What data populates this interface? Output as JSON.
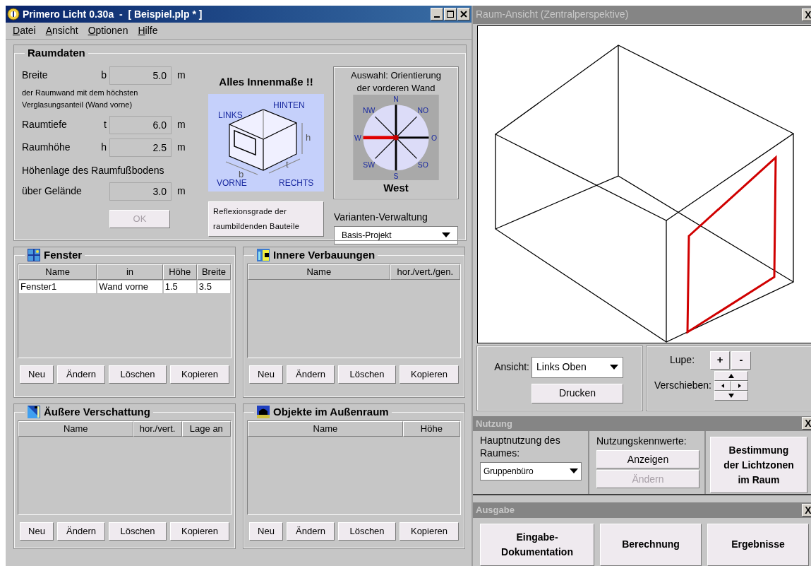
{
  "main_window": {
    "title": "Primero Licht 0.30a  -  [ Beispiel.plp * ]",
    "menu": [
      "Datei",
      "Ansicht",
      "Optionen",
      "Hilfe"
    ]
  },
  "raumdaten": {
    "title": "Raumdaten",
    "fields": [
      {
        "label": "Breite",
        "symbol": "b",
        "value": "5.0",
        "unit": "m"
      },
      {
        "label": "Raumtiefe",
        "symbol": "t",
        "value": "6.0",
        "unit": "m"
      },
      {
        "label": "Raumhöhe",
        "symbol": "h",
        "value": "2.5",
        "unit": "m"
      }
    ],
    "note": "der Raumwand mit dem höchsten Verglasungsanteil (Wand vorne)",
    "floor": {
      "label_1": "Höhenlage des Raumfußbodens",
      "label_2": "über Gelände",
      "value": "3.0",
      "unit": "m"
    },
    "ok_button": {
      "label": "OK",
      "disabled": true
    },
    "diagram": {
      "heading": "Alles Innenmaße !!",
      "labels": [
        "LINKS",
        "HINTEN",
        "h",
        "b",
        "t",
        "VORNE",
        "RECHTS"
      ]
    },
    "reflexion_button": "Reflexionsgrade der raumbildenden Bauteile",
    "orientation": {
      "title": "Auswahl: Orientierung der vorderen Wand",
      "result": "West",
      "directions": [
        {
          "label": "N",
          "selected": false
        },
        {
          "label": "NO",
          "selected": false
        },
        {
          "label": "O",
          "selected": false
        },
        {
          "label": "SO",
          "selected": false
        },
        {
          "label": "S",
          "selected": false
        },
        {
          "label": "SW",
          "selected": false
        },
        {
          "label": "W",
          "selected": true
        },
        {
          "label": "NW",
          "selected": false
        }
      ]
    },
    "varianten": {
      "label": "Varianten-Verwaltung",
      "value": "Basis-Projekt"
    }
  },
  "panels": [
    {
      "title": "Fenster",
      "kind": "window",
      "columns": [
        "Name",
        "in",
        "Höhe",
        "Breite"
      ],
      "rows": [
        [
          "Fenster1",
          "Wand vorne",
          "1.5",
          "3.5"
        ]
      ],
      "buttons": [
        "Neu",
        "Ändern",
        "Löschen",
        "Kopieren"
      ]
    },
    {
      "title": "Innere Verbauungen",
      "kind": "interior",
      "columns": [
        "Name",
        "hor./vert./gen."
      ],
      "buttons": [
        "Neu",
        "Ändern",
        "Löschen",
        "Kopieren"
      ]
    },
    {
      "title": "Äußere Verschattung",
      "kind": "shading",
      "columns": [
        "Name",
        "hor./vert.",
        "Lage an"
      ],
      "buttons": [
        "Neu",
        "Ändern",
        "Löschen",
        "Kopieren"
      ]
    },
    {
      "title": "Objekte im Außenraum",
      "kind": "object",
      "columns": [
        "Name",
        "Höhe"
      ],
      "buttons": [
        "Neu",
        "Ändern",
        "Löschen",
        "Kopieren"
      ]
    }
  ],
  "view_window": {
    "title": "Raum-Ansicht (Zentralperspektive)",
    "close": "X",
    "ansicht_label": "Ansicht:",
    "ansicht_value": "Links Oben",
    "print_button": "Drucken",
    "lupe_label": "Lupe:",
    "zoom_in": "+",
    "zoom_out": "-",
    "move_label": "Verschieben:"
  },
  "nutzung": {
    "title": "Nutzung",
    "close": "X",
    "usage_label": "Hauptnutzung des Raumes:",
    "usage_value": "Gruppenbüro",
    "values_label": "Nutzungskennwerte:",
    "buttons": [
      {
        "label": "Anzeigen",
        "disabled": false
      },
      {
        "label": "Ändern",
        "disabled": true
      }
    ],
    "zones_button": "Bestimmung der Lichtzonen im Raum"
  },
  "ausgabe": {
    "title": "Ausgabe",
    "close": "X",
    "buttons": [
      "Eingabe-Dokumentation",
      "Berechnung",
      "Ergebnisse"
    ]
  }
}
